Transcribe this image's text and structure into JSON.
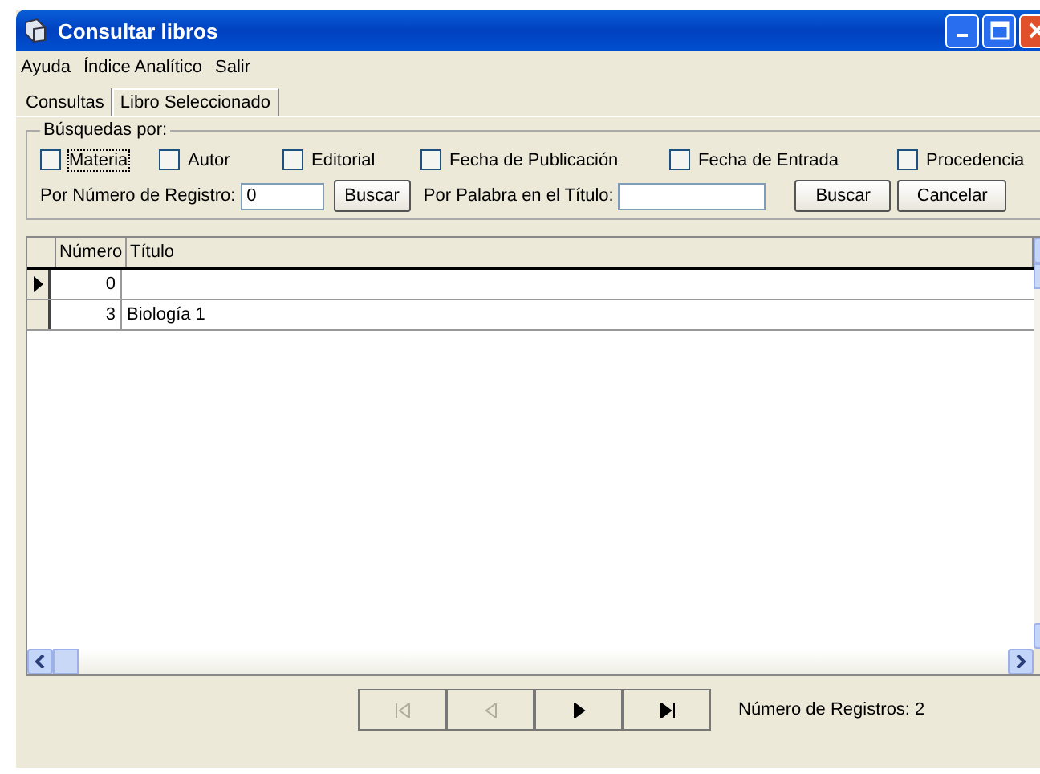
{
  "window": {
    "title": "Consultar libros"
  },
  "menu": [
    "Ayuda",
    "Índice Analítico",
    "Salir"
  ],
  "tabs": [
    {
      "label": "Consultas",
      "selected": true
    },
    {
      "label": "Libro Seleccionado",
      "selected": false
    }
  ],
  "search_group": {
    "title": "Búsquedas por:",
    "checkboxes": [
      {
        "label": "Materia",
        "checked": false,
        "focused": true
      },
      {
        "label": "Autor",
        "checked": false,
        "focused": false
      },
      {
        "label": "Editorial",
        "checked": false,
        "focused": false
      },
      {
        "label": "Fecha de Publicación",
        "checked": false,
        "focused": false
      },
      {
        "label": "Fecha de Entrada",
        "checked": false,
        "focused": false
      },
      {
        "label": "Procedencia",
        "checked": false,
        "focused": false
      }
    ],
    "registro_label": "Por Número de Registro:",
    "registro_value": "0",
    "registro_button": "Buscar",
    "titulo_label": "Por Palabra en el Título:",
    "titulo_button": "Buscar",
    "cancel_button": "Cancelar"
  },
  "table": {
    "columns": [
      "Número",
      "Título"
    ],
    "rows": [
      {
        "numero": "0",
        "titulo": "",
        "selected": true
      },
      {
        "numero": "3",
        "titulo": "Biología 1",
        "selected": false
      }
    ]
  },
  "navigator": [
    {
      "kind": "first",
      "disabled": true
    },
    {
      "kind": "prev",
      "disabled": true
    },
    {
      "kind": "next",
      "disabled": false
    },
    {
      "kind": "last",
      "disabled": false
    }
  ],
  "record_count": "Número de Registros: 2"
}
